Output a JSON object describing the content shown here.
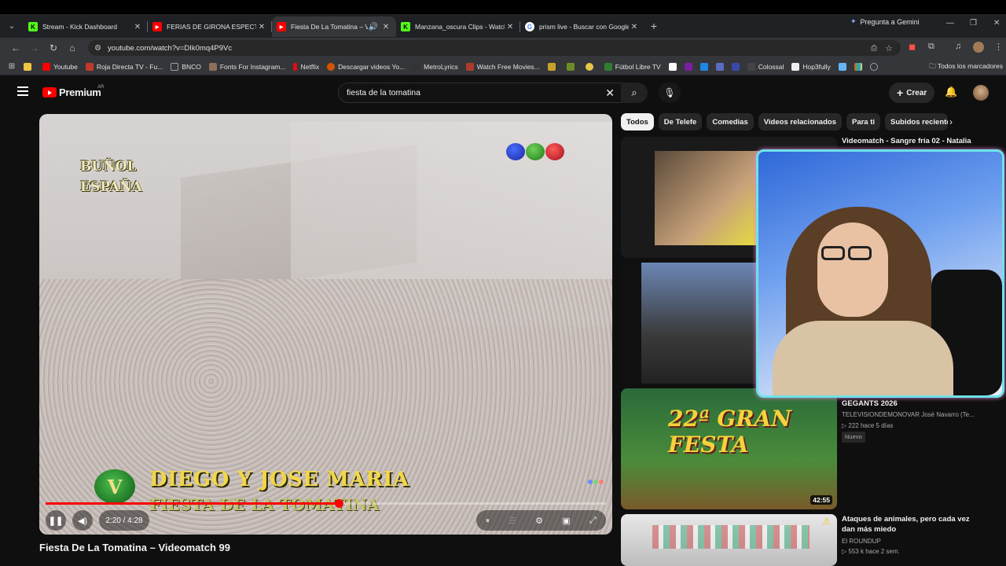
{
  "browser": {
    "tabs": [
      {
        "title": "Stream - Kick Dashboard",
        "fav": "K",
        "fav_color": "#53fc18",
        "active": false
      },
      {
        "title": "FERIAS DE GIRONA ESPECTÁCU...",
        "fav": "▶",
        "fav_color": "#ff0000",
        "active": false
      },
      {
        "title": "Fiesta De La Tomatina – Vid...",
        "fav": "▶",
        "fav_color": "#ff0000",
        "active": true
      },
      {
        "title": "Manzana_oscura Clips - Watch",
        "fav": "K",
        "fav_color": "#53fc18",
        "active": false
      },
      {
        "title": "prism live - Buscar con Google",
        "fav": "G",
        "fav_color": "#4285f4",
        "active": false
      }
    ],
    "gemini_label": "Pregunta a Gemini",
    "url": "youtube.com/watch?v=DIk0mq4P9Vc",
    "bookmarks": [
      {
        "label": "",
        "color": "#f0c542"
      },
      {
        "label": "Youtube",
        "color": "#ff0000"
      },
      {
        "label": "Roja Directa TV - Fu...",
        "color": "#c0392b"
      },
      {
        "label": "BNCO",
        "color": "#9aa0a6"
      },
      {
        "label": "Fonts For Instagram...",
        "color": "#8e6f5a"
      },
      {
        "label": "Netflix",
        "color": "#e50914"
      },
      {
        "label": "Descargar videos Yo...",
        "color": "#d35400"
      },
      {
        "label": "MetroLyrics",
        "color": "#333333"
      },
      {
        "label": "Watch Free Movies...",
        "color": "#b03a2e"
      },
      {
        "label": "Fútbol Libre TV",
        "color": "#2e7d32"
      },
      {
        "label": "Colossal",
        "color": "#444444"
      },
      {
        "label": "Hop3fully",
        "color": "#777777"
      }
    ],
    "all_bookmarks": "Todos los marcadores"
  },
  "youtube": {
    "logo_text": "Premium",
    "region": "AR",
    "search_value": "fiesta de la tomatina",
    "create_label": "Crear"
  },
  "player": {
    "overlay_top": "BUÑOL\nESPAÑA",
    "caption_line1": "DIEGO Y JOSE MARIA",
    "caption_line2": "FIESTA DE LA TOMATINA",
    "vm_logo": "V",
    "time": "2:20 / 4:28",
    "progress_fraction": 0.523
  },
  "video_title": "Fiesta De La Tomatina – Videomatch 99",
  "chips": [
    "Todos",
    "De Telefe",
    "Comedias",
    "Videos relacionados",
    "Para ti",
    "Subidos recientes"
  ],
  "recommendations": [
    {
      "title": "Videomatch - Sangre fría 02 - Natalia",
      "channel": "",
      "views": "",
      "age": ""
    },
    {
      "title": "",
      "channel": "",
      "views": "",
      "age": ""
    },
    {
      "title": "GEGANTS 2026",
      "channel": "TELEVISIONDEMONOVAR José Navarro (Te...",
      "views": "222",
      "age": "hace 5 días",
      "badge": "Nuevo",
      "duration": "42:55",
      "thumb_text": "22ª GRAN FESTA"
    },
    {
      "title": "Ataques de animales, pero cada vez dan más miedo",
      "channel": "El ROUNDUP",
      "views": "553 k",
      "age": "hace 2 sem."
    }
  ]
}
